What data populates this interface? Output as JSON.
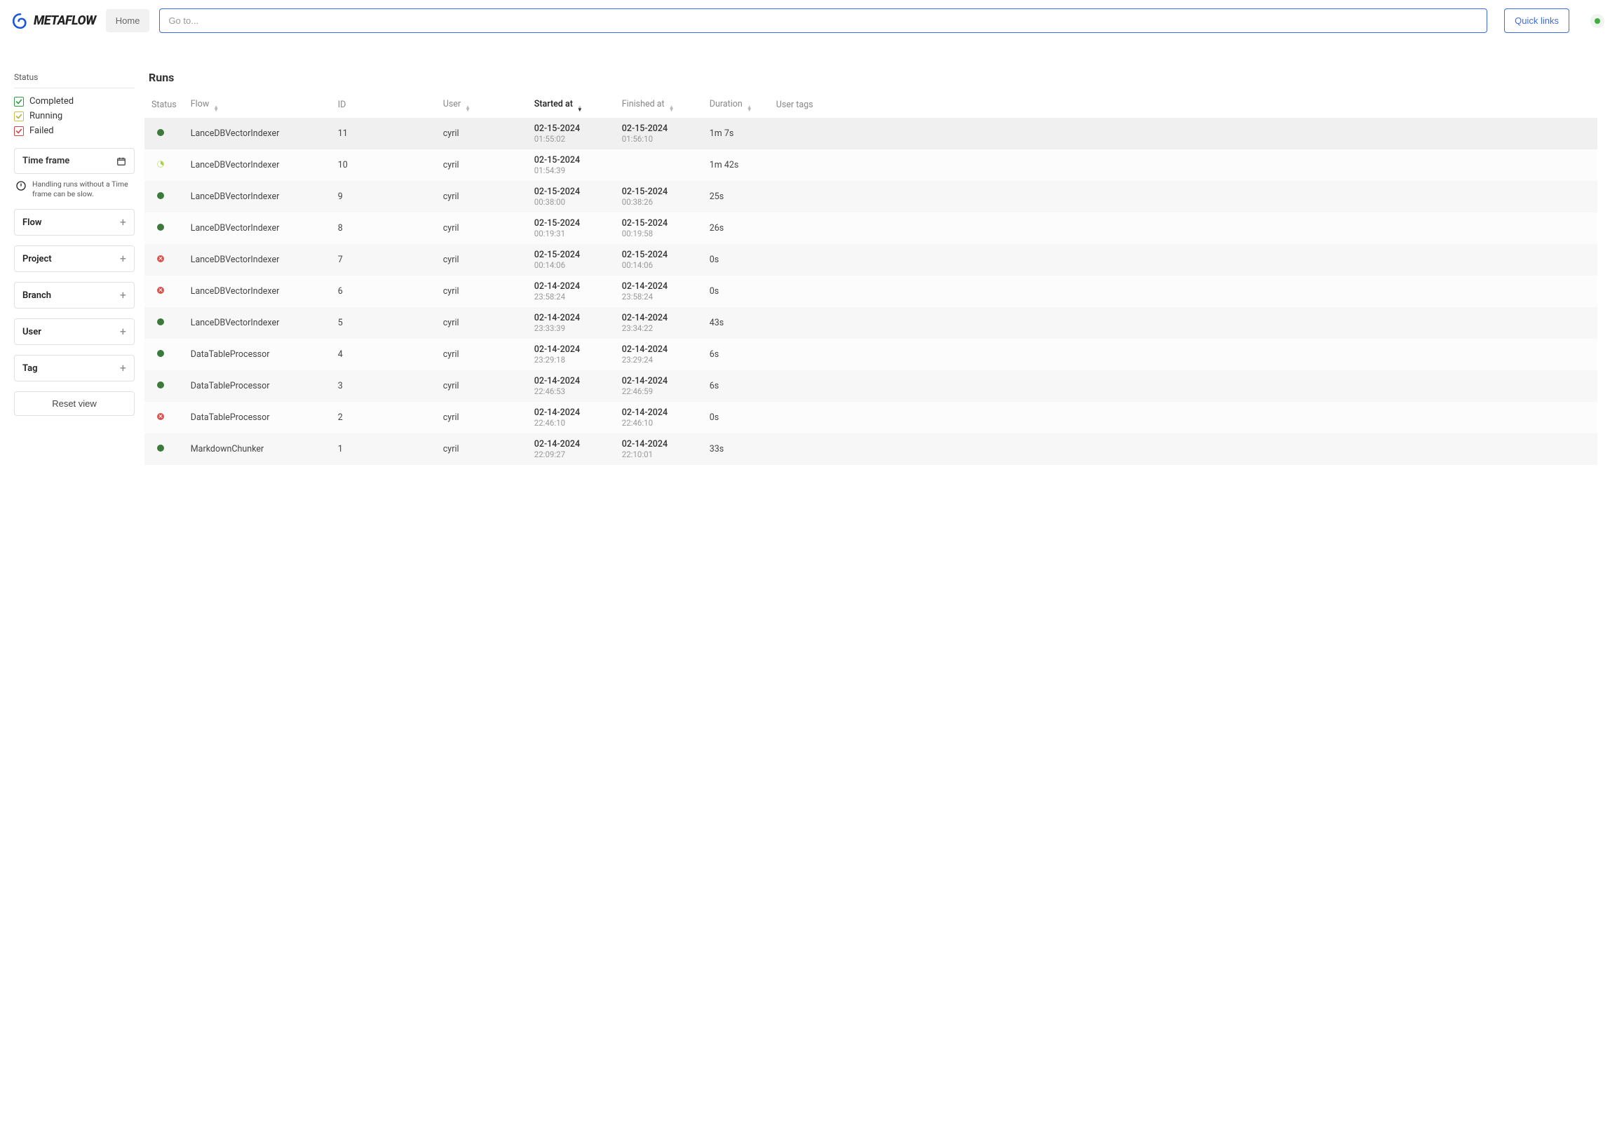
{
  "header": {
    "brand": "METAFLOW",
    "home_label": "Home",
    "search_placeholder": "Go to...",
    "quick_links_label": "Quick links"
  },
  "sidebar": {
    "status_title": "Status",
    "status_options": [
      {
        "key": "completed",
        "label": "Completed"
      },
      {
        "key": "running",
        "label": "Running"
      },
      {
        "key": "failed",
        "label": "Failed"
      }
    ],
    "timeframe_label": "Time frame",
    "timeframe_warning": "Handling runs without a Time frame can be slow.",
    "filters": [
      {
        "key": "flow",
        "label": "Flow"
      },
      {
        "key": "project",
        "label": "Project"
      },
      {
        "key": "branch",
        "label": "Branch"
      },
      {
        "key": "user",
        "label": "User"
      },
      {
        "key": "tag",
        "label": "Tag"
      }
    ],
    "reset_label": "Reset view"
  },
  "page": {
    "title": "Runs"
  },
  "table": {
    "columns": {
      "status": "Status",
      "flow": "Flow",
      "id": "ID",
      "user": "User",
      "started_at": "Started at",
      "finished_at": "Finished at",
      "duration": "Duration",
      "user_tags": "User tags"
    },
    "rows": [
      {
        "status": "done",
        "flow": "LanceDBVectorIndexer",
        "id": "11",
        "user": "cyril",
        "started_date": "02-15-2024",
        "started_time": "01:55:02",
        "finished_date": "02-15-2024",
        "finished_time": "01:56:10",
        "duration": "1m 7s"
      },
      {
        "status": "run",
        "flow": "LanceDBVectorIndexer",
        "id": "10",
        "user": "cyril",
        "started_date": "02-15-2024",
        "started_time": "01:54:39",
        "finished_date": "",
        "finished_time": "",
        "duration": "1m 42s"
      },
      {
        "status": "done",
        "flow": "LanceDBVectorIndexer",
        "id": "9",
        "user": "cyril",
        "started_date": "02-15-2024",
        "started_time": "00:38:00",
        "finished_date": "02-15-2024",
        "finished_time": "00:38:26",
        "duration": "25s"
      },
      {
        "status": "done",
        "flow": "LanceDBVectorIndexer",
        "id": "8",
        "user": "cyril",
        "started_date": "02-15-2024",
        "started_time": "00:19:31",
        "finished_date": "02-15-2024",
        "finished_time": "00:19:58",
        "duration": "26s"
      },
      {
        "status": "fail",
        "flow": "LanceDBVectorIndexer",
        "id": "7",
        "user": "cyril",
        "started_date": "02-15-2024",
        "started_time": "00:14:06",
        "finished_date": "02-15-2024",
        "finished_time": "00:14:06",
        "duration": "0s"
      },
      {
        "status": "fail",
        "flow": "LanceDBVectorIndexer",
        "id": "6",
        "user": "cyril",
        "started_date": "02-14-2024",
        "started_time": "23:58:24",
        "finished_date": "02-14-2024",
        "finished_time": "23:58:24",
        "duration": "0s"
      },
      {
        "status": "done",
        "flow": "LanceDBVectorIndexer",
        "id": "5",
        "user": "cyril",
        "started_date": "02-14-2024",
        "started_time": "23:33:39",
        "finished_date": "02-14-2024",
        "finished_time": "23:34:22",
        "duration": "43s"
      },
      {
        "status": "done",
        "flow": "DataTableProcessor",
        "id": "4",
        "user": "cyril",
        "started_date": "02-14-2024",
        "started_time": "23:29:18",
        "finished_date": "02-14-2024",
        "finished_time": "23:29:24",
        "duration": "6s"
      },
      {
        "status": "done",
        "flow": "DataTableProcessor",
        "id": "3",
        "user": "cyril",
        "started_date": "02-14-2024",
        "started_time": "22:46:53",
        "finished_date": "02-14-2024",
        "finished_time": "22:46:59",
        "duration": "6s"
      },
      {
        "status": "fail",
        "flow": "DataTableProcessor",
        "id": "2",
        "user": "cyril",
        "started_date": "02-14-2024",
        "started_time": "22:46:10",
        "finished_date": "02-14-2024",
        "finished_time": "22:46:10",
        "duration": "0s"
      },
      {
        "status": "done",
        "flow": "MarkdownChunker",
        "id": "1",
        "user": "cyril",
        "started_date": "02-14-2024",
        "started_time": "22:09:27",
        "finished_date": "02-14-2024",
        "finished_time": "22:10:01",
        "duration": "33s"
      }
    ]
  }
}
